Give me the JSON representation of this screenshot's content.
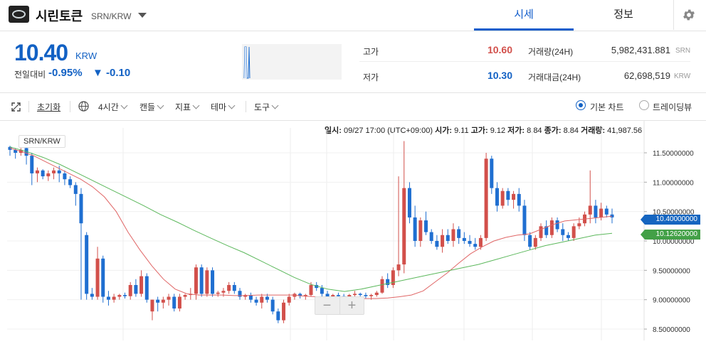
{
  "header": {
    "coin_name": "시린토큰",
    "pair": "SRN/KRW",
    "tab_price": "시세",
    "tab_info": "정보"
  },
  "summary": {
    "price": "10.40",
    "unit": "KRW",
    "change_label": "전일대비",
    "change_rate": "-0.95%",
    "change_amount": "▼ -0.10",
    "high_label": "고가",
    "high_value": "10.60",
    "low_label": "저가",
    "low_value": "10.30",
    "volume_label": "거래량(24H)",
    "volume_value": "5,982,431.881",
    "volume_unit": "SRN",
    "amount_label": "거래대금(24H)",
    "amount_value": "62,698,519",
    "amount_unit": "KRW"
  },
  "toolbar": {
    "reset": "초기화",
    "interval": "4시간",
    "candle": "캔들",
    "indicator": "지표",
    "theme": "테마",
    "tools": "도구",
    "basic_chart": "기본 차트",
    "tradingview": "트레이딩뷰"
  },
  "ohlc_readout": {
    "date_label": "일시:",
    "date": "09/27 17:00 (UTC+09:00)",
    "open_label": "시가:",
    "open": "9.11",
    "high_label": "고가:",
    "high": "9.12",
    "low_label": "저가:",
    "low": "8.84",
    "close_label": "종가:",
    "close": "8.84",
    "volume_label": "거래량:",
    "volume": "41,987.56"
  },
  "colors": {
    "up": "#d2504b",
    "down": "#1f6fd1",
    "ma_short": "#e06666",
    "ma_long": "#5cb85c",
    "accent": "#115dcb"
  },
  "icons": {
    "expand": "expand-icon",
    "globe": "globe-icon",
    "settings": "gear-icon"
  },
  "chart_data": {
    "type": "candlestick",
    "symbol": "SRN/KRW",
    "ylim": [
      8.5,
      11.7
    ],
    "y_ticks": [
      "11.50000000",
      "11.00000000",
      "10.50000000",
      "10.00000000",
      "9.50000000",
      "9.00000000",
      "8.50000000"
    ],
    "current_price_label": "10.40000000",
    "ma_label": "10.12620000",
    "candles": [
      {
        "o": 11.6,
        "h": 11.62,
        "l": 11.45,
        "c": 11.55
      },
      {
        "o": 11.55,
        "h": 11.58,
        "l": 11.4,
        "c": 11.5
      },
      {
        "o": 11.5,
        "h": 11.58,
        "l": 11.45,
        "c": 11.55
      },
      {
        "o": 11.58,
        "h": 11.6,
        "l": 11.3,
        "c": 11.45
      },
      {
        "o": 11.45,
        "h": 11.5,
        "l": 10.95,
        "c": 11.15
      },
      {
        "o": 11.15,
        "h": 11.25,
        "l": 11.0,
        "c": 11.2
      },
      {
        "o": 11.2,
        "h": 11.22,
        "l": 11.05,
        "c": 11.1
      },
      {
        "o": 11.1,
        "h": 11.2,
        "l": 11.02,
        "c": 11.15
      },
      {
        "o": 11.15,
        "h": 11.25,
        "l": 11.05,
        "c": 11.2
      },
      {
        "o": 11.2,
        "h": 11.28,
        "l": 11.0,
        "c": 11.15
      },
      {
        "o": 11.15,
        "h": 11.2,
        "l": 10.95,
        "c": 11.05
      },
      {
        "o": 11.05,
        "h": 11.1,
        "l": 10.9,
        "c": 10.95
      },
      {
        "o": 10.95,
        "h": 11.0,
        "l": 10.6,
        "c": 10.8
      },
      {
        "o": 10.8,
        "h": 10.9,
        "l": 9.0,
        "c": 10.3
      },
      {
        "o": 10.1,
        "h": 10.15,
        "l": 9.0,
        "c": 9.1
      },
      {
        "o": 9.1,
        "h": 9.2,
        "l": 9.0,
        "c": 9.05
      },
      {
        "o": 9.05,
        "h": 9.9,
        "l": 9.0,
        "c": 9.7
      },
      {
        "o": 9.7,
        "h": 9.75,
        "l": 8.95,
        "c": 9.05
      },
      {
        "o": 9.05,
        "h": 9.15,
        "l": 8.9,
        "c": 9.0
      },
      {
        "o": 9.0,
        "h": 9.1,
        "l": 8.95,
        "c": 9.05
      },
      {
        "o": 9.05,
        "h": 9.1,
        "l": 9.0,
        "c": 9.08
      },
      {
        "o": 9.08,
        "h": 9.12,
        "l": 9.02,
        "c": 9.06
      },
      {
        "o": 9.06,
        "h": 9.3,
        "l": 9.0,
        "c": 9.25
      },
      {
        "o": 9.25,
        "h": 9.35,
        "l": 9.05,
        "c": 9.1
      },
      {
        "o": 9.1,
        "h": 9.5,
        "l": 9.05,
        "c": 9.4
      },
      {
        "o": 9.4,
        "h": 9.45,
        "l": 8.95,
        "c": 9.0
      },
      {
        "o": 8.8,
        "h": 9.0,
        "l": 8.65,
        "c": 9.0
      },
      {
        "o": 9.0,
        "h": 9.05,
        "l": 8.8,
        "c": 8.95
      },
      {
        "o": 8.95,
        "h": 9.05,
        "l": 8.85,
        "c": 9.0
      },
      {
        "o": 9.0,
        "h": 9.1,
        "l": 8.9,
        "c": 9.05
      },
      {
        "o": 9.05,
        "h": 9.1,
        "l": 8.8,
        "c": 8.85
      },
      {
        "o": 8.85,
        "h": 9.1,
        "l": 8.8,
        "c": 9.05
      },
      {
        "o": 9.05,
        "h": 9.1,
        "l": 9.0,
        "c": 9.08
      },
      {
        "o": 9.08,
        "h": 9.2,
        "l": 9.0,
        "c": 9.1
      },
      {
        "o": 9.1,
        "h": 9.6,
        "l": 9.0,
        "c": 9.55
      },
      {
        "o": 9.55,
        "h": 9.6,
        "l": 9.05,
        "c": 9.1
      },
      {
        "o": 9.1,
        "h": 9.55,
        "l": 9.05,
        "c": 9.5
      },
      {
        "o": 9.5,
        "h": 9.55,
        "l": 9.05,
        "c": 9.1
      },
      {
        "o": 9.1,
        "h": 9.15,
        "l": 9.05,
        "c": 9.12
      },
      {
        "o": 9.12,
        "h": 9.2,
        "l": 9.05,
        "c": 9.15
      },
      {
        "o": 9.15,
        "h": 9.3,
        "l": 9.1,
        "c": 9.25
      },
      {
        "o": 9.25,
        "h": 9.3,
        "l": 9.1,
        "c": 9.15
      },
      {
        "o": 9.15,
        "h": 9.2,
        "l": 9.0,
        "c": 9.05
      },
      {
        "o": 9.05,
        "h": 9.1,
        "l": 9.0,
        "c": 9.08
      },
      {
        "o": 9.08,
        "h": 9.12,
        "l": 8.95,
        "c": 9.0
      },
      {
        "o": 9.0,
        "h": 9.05,
        "l": 8.9,
        "c": 8.95
      },
      {
        "o": 8.95,
        "h": 9.1,
        "l": 8.85,
        "c": 9.05
      },
      {
        "o": 9.05,
        "h": 9.1,
        "l": 8.95,
        "c": 9.0
      },
      {
        "o": 9.0,
        "h": 9.05,
        "l": 8.75,
        "c": 8.8
      },
      {
        "o": 8.8,
        "h": 8.85,
        "l": 8.6,
        "c": 8.65
      },
      {
        "o": 8.65,
        "h": 9.0,
        "l": 8.6,
        "c": 8.95
      },
      {
        "o": 8.95,
        "h": 9.1,
        "l": 8.9,
        "c": 9.05
      },
      {
        "o": 9.05,
        "h": 9.12,
        "l": 9.0,
        "c": 9.1
      },
      {
        "o": 9.1,
        "h": 9.12,
        "l": 9.02,
        "c": 9.06
      },
      {
        "o": 9.06,
        "h": 9.1,
        "l": 9.0,
        "c": 9.08
      },
      {
        "o": 9.08,
        "h": 9.3,
        "l": 9.05,
        "c": 9.25
      },
      {
        "o": 9.25,
        "h": 9.3,
        "l": 9.15,
        "c": 9.2
      },
      {
        "o": 9.2,
        "h": 9.25,
        "l": 9.05,
        "c": 9.1
      },
      {
        "o": 9.1,
        "h": 9.15,
        "l": 9.0,
        "c": 9.05
      },
      {
        "o": 9.05,
        "h": 9.1,
        "l": 9.0,
        "c": 9.08
      },
      {
        "o": 9.08,
        "h": 9.12,
        "l": 9.02,
        "c": 9.06
      },
      {
        "o": 9.06,
        "h": 9.1,
        "l": 9.0,
        "c": 9.05
      },
      {
        "o": 9.05,
        "h": 9.1,
        "l": 9.0,
        "c": 9.08
      },
      {
        "o": 9.08,
        "h": 9.15,
        "l": 9.05,
        "c": 9.1
      },
      {
        "o": 9.1,
        "h": 9.12,
        "l": 9.05,
        "c": 9.08
      },
      {
        "o": 9.08,
        "h": 9.12,
        "l": 9.02,
        "c": 9.06
      },
      {
        "o": 9.06,
        "h": 9.1,
        "l": 9.0,
        "c": 9.08
      },
      {
        "o": 9.08,
        "h": 9.15,
        "l": 9.05,
        "c": 9.12
      },
      {
        "o": 9.12,
        "h": 9.4,
        "l": 9.1,
        "c": 9.35
      },
      {
        "o": 9.35,
        "h": 9.45,
        "l": 9.2,
        "c": 9.25
      },
      {
        "o": 9.25,
        "h": 9.55,
        "l": 9.2,
        "c": 9.5
      },
      {
        "o": 9.5,
        "h": 11.1,
        "l": 9.4,
        "c": 9.6
      },
      {
        "o": 9.6,
        "h": 11.7,
        "l": 9.45,
        "c": 10.9
      },
      {
        "o": 10.9,
        "h": 11.0,
        "l": 10.3,
        "c": 10.4
      },
      {
        "o": 10.4,
        "h": 10.6,
        "l": 9.9,
        "c": 10.0
      },
      {
        "o": 10.0,
        "h": 10.4,
        "l": 9.9,
        "c": 10.35
      },
      {
        "o": 10.35,
        "h": 10.5,
        "l": 10.1,
        "c": 10.15
      },
      {
        "o": 10.15,
        "h": 10.2,
        "l": 9.95,
        "c": 10.0
      },
      {
        "o": 10.0,
        "h": 10.1,
        "l": 9.85,
        "c": 9.9
      },
      {
        "o": 9.9,
        "h": 10.2,
        "l": 9.8,
        "c": 10.1
      },
      {
        "o": 10.1,
        "h": 10.2,
        "l": 9.95,
        "c": 10.0
      },
      {
        "o": 10.0,
        "h": 10.3,
        "l": 9.9,
        "c": 10.2
      },
      {
        "o": 10.2,
        "h": 10.25,
        "l": 9.95,
        "c": 10.05
      },
      {
        "o": 10.05,
        "h": 10.15,
        "l": 9.95,
        "c": 10.0
      },
      {
        "o": 10.0,
        "h": 10.1,
        "l": 9.9,
        "c": 9.95
      },
      {
        "o": 9.95,
        "h": 10.05,
        "l": 9.85,
        "c": 9.9
      },
      {
        "o": 9.9,
        "h": 10.1,
        "l": 9.85,
        "c": 10.05
      },
      {
        "o": 10.05,
        "h": 11.5,
        "l": 10.0,
        "c": 11.4
      },
      {
        "o": 11.4,
        "h": 11.45,
        "l": 10.8,
        "c": 10.9
      },
      {
        "o": 10.9,
        "h": 11.0,
        "l": 10.5,
        "c": 10.6
      },
      {
        "o": 10.6,
        "h": 10.9,
        "l": 10.55,
        "c": 10.85
      },
      {
        "o": 10.85,
        "h": 10.9,
        "l": 10.6,
        "c": 10.7
      },
      {
        "o": 10.7,
        "h": 10.85,
        "l": 10.55,
        "c": 10.8
      },
      {
        "o": 10.8,
        "h": 10.9,
        "l": 10.5,
        "c": 10.6
      },
      {
        "o": 10.6,
        "h": 10.7,
        "l": 10.0,
        "c": 10.1
      },
      {
        "o": 10.1,
        "h": 10.15,
        "l": 9.85,
        "c": 9.9
      },
      {
        "o": 9.9,
        "h": 10.1,
        "l": 9.85,
        "c": 10.05
      },
      {
        "o": 10.05,
        "h": 10.3,
        "l": 10.0,
        "c": 10.25
      },
      {
        "o": 10.25,
        "h": 10.35,
        "l": 10.05,
        "c": 10.1
      },
      {
        "o": 10.1,
        "h": 10.4,
        "l": 10.05,
        "c": 10.35
      },
      {
        "o": 10.35,
        "h": 10.4,
        "l": 10.15,
        "c": 10.2
      },
      {
        "o": 10.2,
        "h": 10.3,
        "l": 10.0,
        "c": 10.1
      },
      {
        "o": 10.1,
        "h": 10.15,
        "l": 10.0,
        "c": 10.05
      },
      {
        "o": 10.05,
        "h": 10.3,
        "l": 10.0,
        "c": 10.25
      },
      {
        "o": 10.25,
        "h": 10.4,
        "l": 10.2,
        "c": 10.3
      },
      {
        "o": 10.3,
        "h": 10.5,
        "l": 10.25,
        "c": 10.45
      },
      {
        "o": 10.45,
        "h": 11.2,
        "l": 10.3,
        "c": 10.6
      },
      {
        "o": 10.6,
        "h": 10.7,
        "l": 10.3,
        "c": 10.4
      },
      {
        "o": 10.4,
        "h": 10.65,
        "l": 10.35,
        "c": 10.55
      },
      {
        "o": 10.55,
        "h": 10.6,
        "l": 10.4,
        "c": 10.45
      },
      {
        "o": 10.45,
        "h": 10.55,
        "l": 10.3,
        "c": 10.4
      }
    ],
    "ma_short": [
      11.58,
      11.52,
      11.45,
      11.35,
      11.25,
      11.15,
      11.05,
      10.92,
      10.75,
      10.5,
      10.15,
      9.85,
      9.58,
      9.35,
      9.18,
      9.1,
      9.08,
      9.08,
      9.08,
      9.07,
      9.07,
      9.08,
      9.08,
      9.08,
      9.08,
      9.06,
      9.05,
      9.05,
      9.03,
      9.02,
      9.02,
      9.02,
      9.03,
      9.05,
      9.08,
      9.15,
      9.3,
      9.45,
      9.62,
      9.78,
      9.9,
      10.0,
      10.06,
      10.1,
      10.12,
      10.2,
      10.28,
      10.34,
      10.36,
      10.38,
      10.4,
      10.42
    ],
    "ma_long": [
      11.6,
      11.52,
      11.42,
      11.3,
      11.16,
      11.02,
      10.88,
      10.74,
      10.6,
      10.45,
      10.32,
      10.18,
      10.05,
      9.92,
      9.8,
      9.66,
      9.52,
      9.38,
      9.26,
      9.18,
      9.14,
      9.18,
      9.24,
      9.3,
      9.36,
      9.42,
      9.48,
      9.54,
      9.6,
      9.68,
      9.76,
      9.84,
      9.92,
      9.98,
      10.04,
      10.1,
      10.13
    ]
  }
}
